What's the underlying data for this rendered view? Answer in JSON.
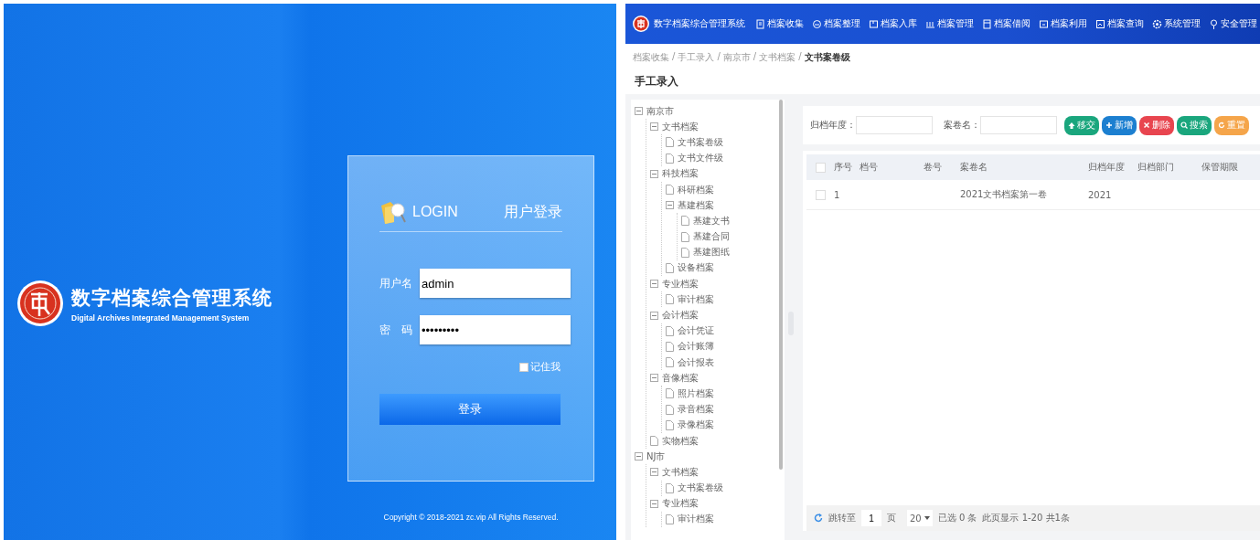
{
  "login_screen": {
    "brand": {
      "title": "数字档案综合管理系统",
      "subtitle": "Digital Archives Integrated Management System"
    },
    "card": {
      "login_label": "LOGIN",
      "heading": "用户登录",
      "fields": [
        {
          "label": "用户名",
          "value": "admin"
        },
        {
          "label": "密　码",
          "value": "•••••••••"
        }
      ],
      "remember": {
        "label": "记住我",
        "checked": false
      },
      "submit": "登录"
    },
    "copyright": "Copyright © 2018-2021 zc.vip All Rights Reserved."
  },
  "app_screen": {
    "header": {
      "title": "数字档案综合管理系统",
      "nav": [
        {
          "label": "档案收集"
        },
        {
          "label": "档案整理"
        },
        {
          "label": "档案入库"
        },
        {
          "label": "档案管理"
        },
        {
          "label": "档案借阅"
        },
        {
          "label": "档案利用"
        },
        {
          "label": "档案查询"
        },
        {
          "label": "系统管理"
        },
        {
          "label": "安全管理"
        }
      ]
    },
    "breadcrumb": {
      "separator": "/",
      "items": [
        "档案收集",
        "手工录入",
        "南京市",
        "文书档案",
        "文书案卷级"
      ]
    },
    "page_title": "手工录入",
    "tree": [
      {
        "label": "南京市",
        "expanded": true,
        "children": [
          {
            "label": "文书档案",
            "expanded": true,
            "children": [
              {
                "label": "文书案卷级"
              },
              {
                "label": "文书文件级"
              }
            ]
          },
          {
            "label": "科技档案",
            "expanded": true,
            "children": [
              {
                "label": "科研档案"
              },
              {
                "label": "基建档案",
                "expanded": true,
                "children": [
                  {
                    "label": "基建文书"
                  },
                  {
                    "label": "基建合同"
                  },
                  {
                    "label": "基建图纸"
                  }
                ]
              },
              {
                "label": "设备档案"
              }
            ]
          },
          {
            "label": "专业档案",
            "expanded": true,
            "children": [
              {
                "label": "审计档案"
              }
            ]
          },
          {
            "label": "会计档案",
            "expanded": true,
            "children": [
              {
                "label": "会计凭证"
              },
              {
                "label": "会计账簿"
              },
              {
                "label": "会计报表"
              }
            ]
          },
          {
            "label": "音像档案",
            "expanded": true,
            "children": [
              {
                "label": "照片档案"
              },
              {
                "label": "录音档案"
              },
              {
                "label": "录像档案"
              }
            ]
          },
          {
            "label": "实物档案"
          }
        ]
      },
      {
        "label": "NJ市",
        "expanded": true,
        "children": [
          {
            "label": "文书档案",
            "expanded": true,
            "children": [
              {
                "label": "文书案卷级"
              }
            ]
          },
          {
            "label": "专业档案",
            "expanded": true,
            "children": [
              {
                "label": "审计档案"
              }
            ]
          }
        ]
      }
    ],
    "filters": [
      {
        "label": "归档年度："
      },
      {
        "label": "案卷名："
      }
    ],
    "buttons": [
      {
        "label": "移交",
        "color": "#1aa67d"
      },
      {
        "label": "新增",
        "color": "#1c7fd0"
      },
      {
        "label": "删除",
        "color": "#e8454f"
      },
      {
        "label": "搜索",
        "color": "#1aa67d"
      },
      {
        "label": "重置",
        "color": "#f5a54a"
      }
    ],
    "table": {
      "select_all_checked": false,
      "columns": [
        "序号",
        "档号",
        "卷号",
        "案卷名",
        "归档年度",
        "归档部门",
        "保管期限"
      ],
      "rows": [
        {
          "selected": false,
          "cells": [
            "1",
            "",
            "",
            "2021文书档案第一卷",
            "2021",
            "",
            ""
          ]
        }
      ]
    },
    "pager": {
      "goto_label": "跳转至",
      "page": "1",
      "page_unit": "页",
      "page_size": "20",
      "selected_count": "已选 0 条",
      "summary": "此页显示 1-20 共1条"
    }
  }
}
